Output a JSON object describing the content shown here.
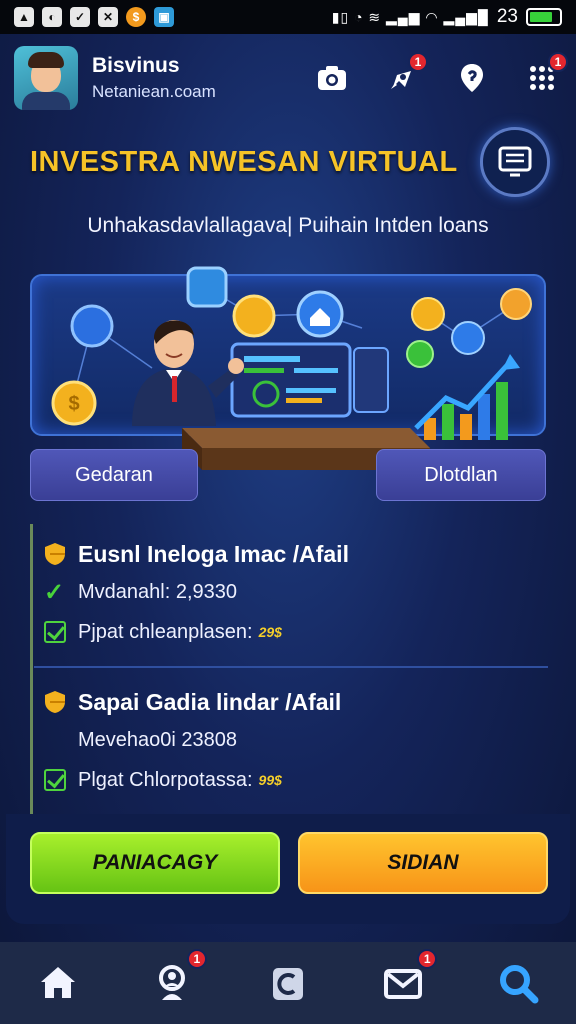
{
  "status_bar": {
    "time": "23",
    "icons": [
      "image-icon",
      "app-icon",
      "check-icon",
      "tools-icon",
      "coin-icon",
      "photo-icon"
    ]
  },
  "header": {
    "user_name": "Bisvinus",
    "user_email": "Netaniean.coam",
    "actions": [
      {
        "icon": "camera-icon",
        "badge": ""
      },
      {
        "icon": "rocket-icon",
        "badge": "1"
      },
      {
        "icon": "location-pin-icon",
        "badge": ""
      },
      {
        "icon": "grid-menu-icon",
        "badge": "1"
      }
    ]
  },
  "title": "INVESTRA NWESAN VIRTUAL",
  "subtitle": "Unhakasdavlallagava| Puihain Intden loans",
  "hero": {
    "left_button": "Gedaran",
    "right_button": "Dlotdlan"
  },
  "offers": [
    {
      "title": "Eusnl Ineloga Imac /Afail",
      "detail": "Mvdanahl: 2,9330",
      "check_label": "Pjpat chleanplasen:",
      "check_value": "29$"
    },
    {
      "title": "Sapai Gadia lindar /Afail",
      "detail": "Mevehao0i 23808",
      "check_label": "Plgat Chlorpotassa:",
      "check_value": "99$"
    }
  ],
  "actions": {
    "primary": "PANIACAGY",
    "secondary": "SIDIAN"
  },
  "bottom_nav": [
    {
      "icon": "home-icon",
      "badge": ""
    },
    {
      "icon": "profile-search-icon",
      "badge": "1"
    },
    {
      "icon": "wallet-icon",
      "badge": ""
    },
    {
      "icon": "mail-icon",
      "badge": "1"
    },
    {
      "icon": "search-icon",
      "badge": ""
    }
  ],
  "colors": {
    "accent_yellow": "#f6c327",
    "primary_green": "#7dd51f",
    "secondary_orange": "#f9a41f",
    "badge_red": "#e3262e",
    "background": "#14245a"
  }
}
